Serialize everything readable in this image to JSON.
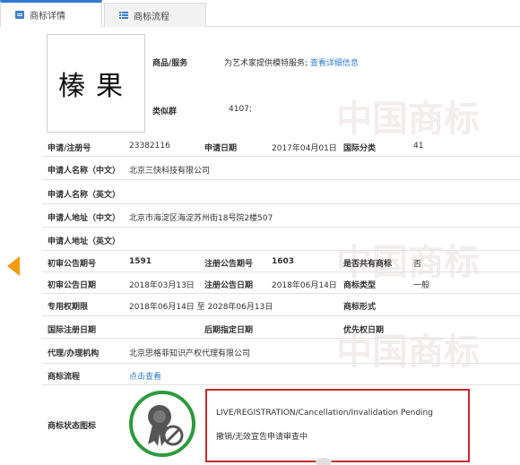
{
  "tabs": [
    {
      "label": "商标详情",
      "icon": "id-card-icon"
    },
    {
      "label": "商标流程",
      "icon": "list-icon"
    }
  ],
  "watermark": "中国商标",
  "trademark": {
    "name": "榛果",
    "goods_label": "商品/服务",
    "goods_value": "为艺术家提供模特服务;",
    "goods_link": "查看详细信息",
    "similar_group_label": "类似群",
    "similar_group_value": "4107;"
  },
  "details": {
    "reg_no_label": "申请/注册号",
    "reg_no": "23382116",
    "app_date_label": "申请日期",
    "app_date": "2017年04月01日",
    "intl_class_label": "国际分类",
    "intl_class": "41",
    "applicant_cn_label": "申请人名称（中文）",
    "applicant_cn": "北京三快科技有限公司",
    "applicant_en_label": "申请人名称（英文）",
    "applicant_en": "",
    "address_cn_label": "申请人地址（中文）",
    "address_cn": "北京市海淀区海淀苏州街18号院2楼507",
    "address_en_label": "申请人地址（英文）",
    "address_en": "",
    "prelim_no_label": "初审公告期号",
    "prelim_no": "1591",
    "reg_pub_no_label": "注册公告期号",
    "reg_pub_no": "1603",
    "shared_label": "是否共有商标",
    "shared": "否",
    "prelim_date_label": "初审公告日期",
    "prelim_date": "2018年03月13日",
    "reg_pub_date_label": "注册公告日期",
    "reg_pub_date": "2018年06月14日",
    "type_label": "商标类型",
    "type": "一般",
    "exclusive_label": "专用权期限",
    "exclusive": "2018年06月14日 至 2028年06月13日",
    "form_label": "商标形式",
    "form": "",
    "intl_reg_date_label": "国际注册日期",
    "intl_reg_date": "",
    "later_date_label": "后期指定日期",
    "later_date": "",
    "priority_date_label": "优先权日期",
    "priority_date": "",
    "agent_label": "代理/办理机构",
    "agent": "北京思格菲知识产权代理有限公司",
    "process_label": "商标流程",
    "process_link": "点击查看",
    "status_icon_label": "商标状态图标"
  },
  "status": {
    "en": "LIVE/REGISTRATION/Cancellation/Invalidation Pending",
    "cn": "撤销/无效宣告申请审查中",
    "icon": "award-badge-blocked-icon",
    "highlight_color": "#c8282d",
    "ring_color": "#2e9a3e"
  }
}
